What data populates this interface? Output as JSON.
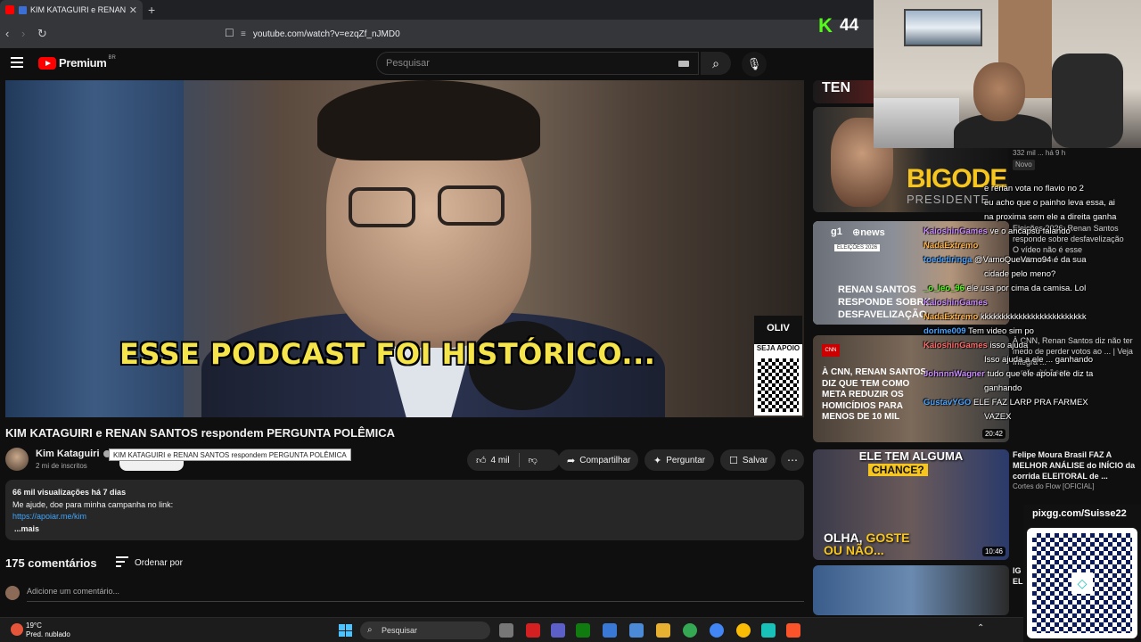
{
  "browser": {
    "tab_title": "KIM KATAGUIRI e RENAN SANTOS",
    "tab_close": "✕",
    "new_tab": "+",
    "url": "youtube.com/watch?v=ezqZf_nJMD0"
  },
  "header": {
    "logo_text": "Premium",
    "logo_region": "BR",
    "search_placeholder": "Pesquisar"
  },
  "video": {
    "caption": "ESSE PODCAST FOI HISTÓRICO...",
    "overlay_brand": "OLIV",
    "overlay_cta": "SEJA APOIO"
  },
  "watch": {
    "title": "KIM KATAGUIRI e RENAN SANTOS respondem PERGUNTA POLÊMICA",
    "tooltip": "KIM KATAGUIRI e RENAN SANTOS respondem PERGUNTA POLÊMICA",
    "channel": "Kim Kataguiri",
    "subscribers": "2 mi de inscritos",
    "likes": "4 mil",
    "share": "Compartilhar",
    "ask": "Perguntar",
    "save": "Salvar",
    "more": "⋯"
  },
  "description": {
    "meta": "66 mil visualizações  há 7 dias",
    "line1": "Me ajude, doe para minha campanha no link:",
    "link": "https://apoiar.me/kim",
    "more": "...mais"
  },
  "comments": {
    "count": "175 comentários",
    "sort": "Ordenar por",
    "placeholder": "Adicione um comentário..."
  },
  "recommendations": {
    "t1_label": "TEN",
    "t2_big": "BIGODE",
    "t2_small": "PRESIDENTE",
    "t2_meta": "332 mil ... há 9 h",
    "t2_badge": "Novo",
    "t3_g1": "g1",
    "t3_news": "⊕news",
    "t3_badge": "ELEIÇÕES 2026",
    "t3_text": "RENAN SANTOS\nRESPONDE SOBRE\nDESFAVELIZAÇÃO",
    "t3_title": "Eleições 2026: Renan Santos responde sobre desfavelização",
    "t3_sub": "O vídeo não é esse",
    "t3_meta": "... mil ... sem.",
    "t4_badge": "CNN",
    "t4_text": "À CNN, RENAN SANTOS\nDIZ QUE TEM COMO\nMETA REDUZIR OS\nHOMICÍDIOS PARA\nMENOS DE 10 MIL",
    "t4_dur": "20:42",
    "t4_title": "À CNN, Renan Santos diz não ter medo de perder votos ao ... | Veja íntegra ...",
    "t4_meta": "... mil ... há 2 sem.",
    "t5_top": "ELE TEM ALGUMA",
    "t5_chance": "CHANCE?",
    "t5_bottom1": "OLHA,",
    "t5_bottom2": "GOSTE",
    "t5_bottom3": "OU NÃO...",
    "t5_dur": "10:46",
    "t5_title": "Felipe Moura Brasil FAZ A MELHOR ANÁLISE do INÍCIO da corrida ELEITORAL de ...",
    "t5_channel": "Cortes do Flow [OFICIAL]",
    "t6_title": "IG\nEL"
  },
  "stream": {
    "viewer_icon": "K",
    "viewer_count": "44",
    "pix_url": "pixgg.com/Suisse22",
    "chat": [
      {
        "user": "",
        "text": "e renan vota no flavio no 2"
      },
      {
        "user": "",
        "text": "eu acho que o painho leva essa, ai"
      },
      {
        "user": "",
        "text": "na proxima sem ele a direita ganha"
      },
      {
        "user": "KaioshinGames",
        "text": "ve o ancapsu falando"
      },
      {
        "user": "NadaExtremo",
        "text": ""
      },
      {
        "user": "toedetiringa",
        "text": "@VamoQueVamo94 é da sua"
      },
      {
        "user": "",
        "text": "cidade pelo meno?"
      },
      {
        "user": "_o_leo_96",
        "text": "ele usa por cima da camisa. Lol"
      },
      {
        "user": "KaioshinGames",
        "text": ""
      },
      {
        "user": "NadaExtremo",
        "text": "kkkkkkkkkkkkkkkkkkkkkkkkk"
      },
      {
        "user": "dorime009",
        "text": "Tem video sim po"
      },
      {
        "user": "KaioshinGames",
        "text": "isso ajuda"
      },
      {
        "user": "",
        "text": "Isso ajuda a ele ... ganhando"
      },
      {
        "user": "JohnnnWagner",
        "text": "tudo que ele apoia ele diz ta"
      },
      {
        "user": "",
        "text": "ganhando"
      },
      {
        "user": "GustavYGO",
        "text": "ELE FAZ LARP PRA FARMEX"
      },
      {
        "user": "",
        "text": "VAZEX"
      }
    ]
  },
  "taskbar": {
    "temp": "19°C",
    "weather": "Pred. nublado",
    "search": "Pesquisar"
  },
  "colors": {
    "yt_red": "#ff0000",
    "caption_yellow": "#f5e44a",
    "link_blue": "#3ea6ff",
    "kick_green": "#53fc18"
  }
}
